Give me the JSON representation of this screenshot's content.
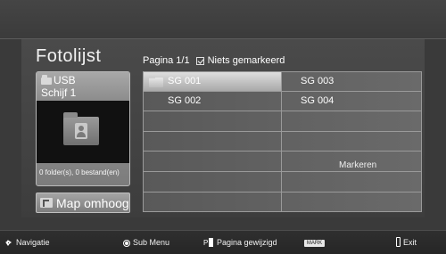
{
  "title": "Fotolijst",
  "device": {
    "line1": "USB",
    "line2": "Schijf 1",
    "counts": "0 folder(s), 0 bestand(en)"
  },
  "up_button": {
    "label": "Map omhoog"
  },
  "header": {
    "page": "Pagina 1/1",
    "marked": "Niets gemarkeerd"
  },
  "items": [
    {
      "label": "SG 001",
      "selected": true
    },
    {
      "label": "SG 003",
      "selected": false
    },
    {
      "label": "SG 002",
      "selected": false
    },
    {
      "label": "SG 004",
      "selected": false
    }
  ],
  "markeren": "Markeren",
  "footer": {
    "navigation": "Navigatie",
    "submenu": "Sub Menu",
    "page_changed": "Pagina gewijzigd",
    "mark_key": "MARK",
    "exit": "Exit"
  },
  "icons": [
    "usb-icon",
    "folder-icon",
    "photo-folder-icon",
    "up-folder-icon",
    "checkbox-icon",
    "navigation-arrows-icon",
    "ok-dot-icon",
    "page-key-icon",
    "mark-key-icon",
    "exit-icon"
  ]
}
